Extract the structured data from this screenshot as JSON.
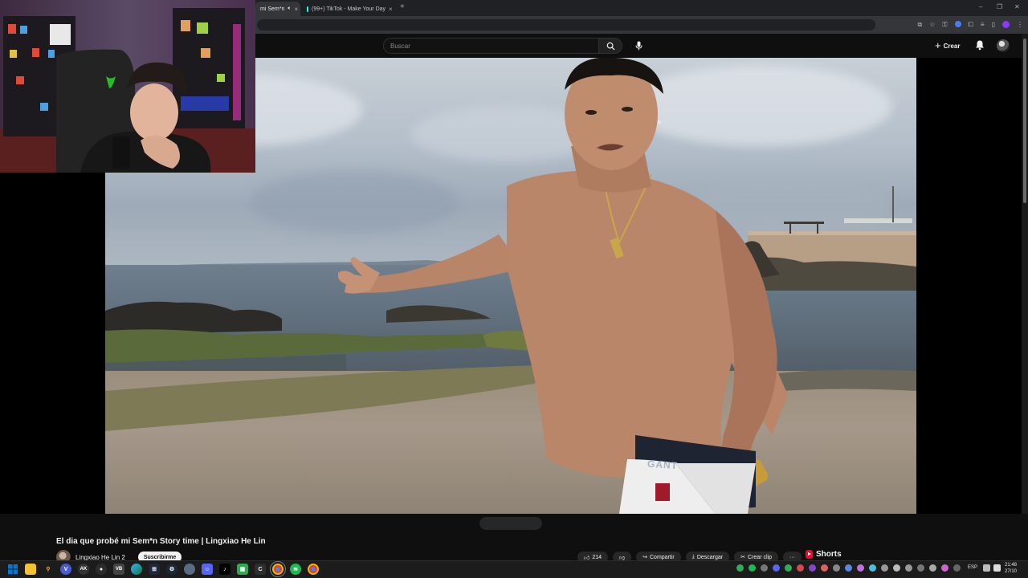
{
  "browser": {
    "tabs": [
      {
        "title": "mi Sem*n",
        "active": true,
        "audio": true
      },
      {
        "title": "(99+) TikTok - Make Your Day",
        "active": false
      }
    ],
    "new_tab": "+",
    "window_controls": {
      "minimize": "–",
      "restore": "❐",
      "close": "✕"
    }
  },
  "youtube": {
    "search": {
      "placeholder": "Buscar"
    },
    "create_label": "Crear",
    "icons": [
      "search-icon",
      "mic-icon",
      "bell-icon"
    ]
  },
  "video": {
    "title": "El dia que probé mi Sem*n Story time | Lingxiao He Lin",
    "channel_name": "Lingxiao He Lin 2",
    "subscribe_label": "Suscribirme",
    "actions": [
      {
        "icon": "like-icon",
        "label": "214"
      },
      {
        "icon": "dislike-icon",
        "label": ""
      },
      {
        "icon": "share-icon",
        "label": "Compartir"
      },
      {
        "icon": "download-icon",
        "label": "Descargar"
      },
      {
        "icon": "clip-icon",
        "label": "Crear clip"
      },
      {
        "icon": "more-icon",
        "label": "···"
      }
    ],
    "shorts_label": "Shorts",
    "shirt_brand": "GANT"
  },
  "taskbar": {
    "apps": [
      "start",
      "file-explorer",
      "search",
      "vpn",
      "app-ak",
      "obs",
      "app-vb",
      "edge",
      "steam",
      "app-globe",
      "discord",
      "tiktok",
      "app-game",
      "sync",
      "chrome-active",
      "spotify",
      "chrome"
    ],
    "language": "ESP",
    "time": "21:48",
    "date": "27/10"
  },
  "colors": {
    "background": "#0f0f0f",
    "shorts_red": "#ff0033",
    "spotify_green": "#1db954",
    "windows_blue": "#0078d4"
  }
}
